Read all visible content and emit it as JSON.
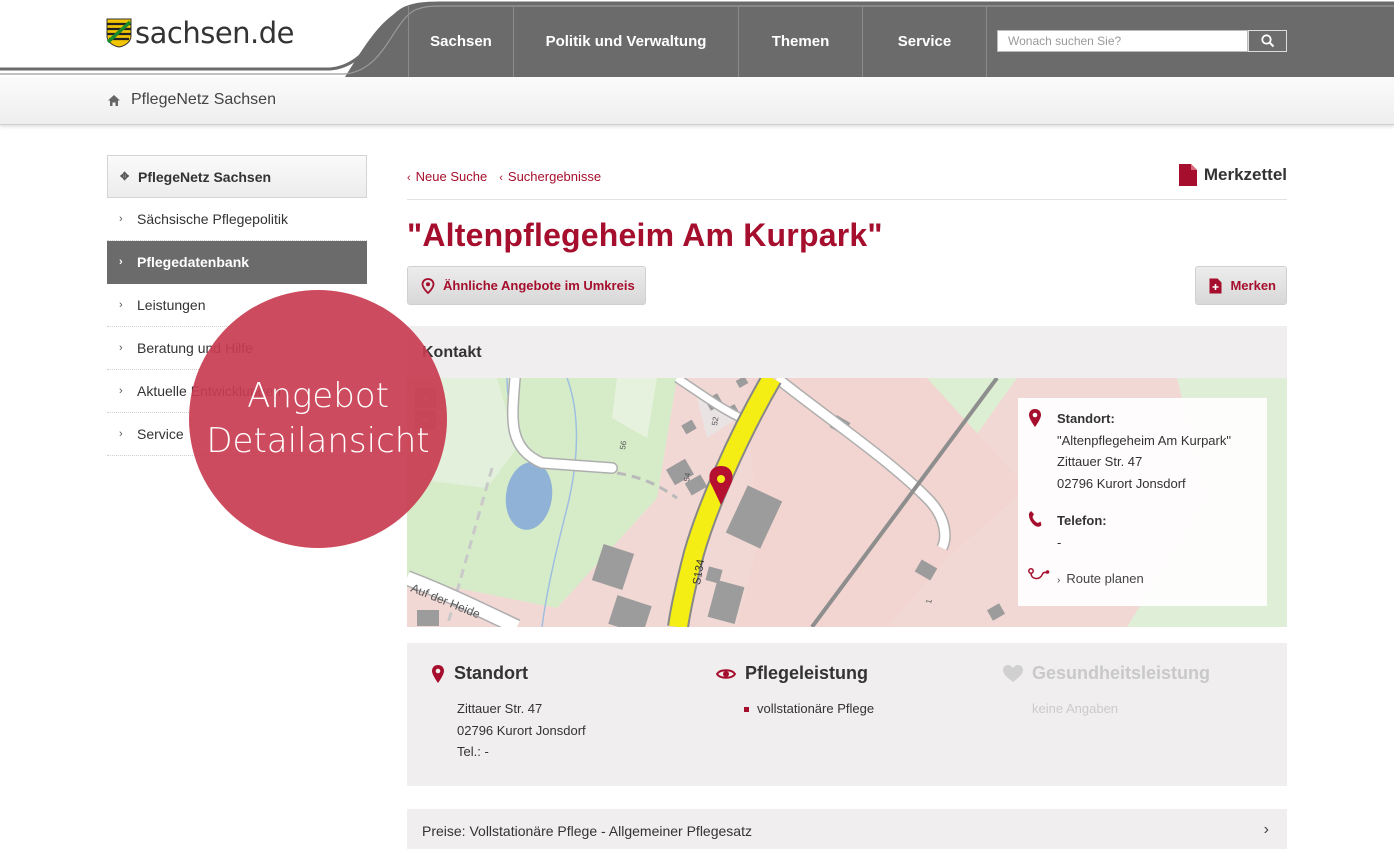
{
  "header": {
    "logo_text": "sachsen.de",
    "nav": [
      {
        "label": "Sachsen"
      },
      {
        "label": "Politik und Verwaltung"
      },
      {
        "label": "Themen"
      },
      {
        "label": "Service"
      }
    ],
    "search_placeholder": "Wonach suchen Sie?"
  },
  "breadcrumb": {
    "label": "PflegeNetz Sachsen"
  },
  "sidebar": {
    "items": [
      {
        "label": "PflegeNetz Sachsen"
      },
      {
        "label": "Sächsische Pflegepolitik"
      },
      {
        "label": "Pflegedatenbank"
      },
      {
        "label": "Leistungen"
      },
      {
        "label": "Beratung und Hilfe"
      },
      {
        "label": "Aktuelle Entwicklungen"
      },
      {
        "label": "Service"
      }
    ]
  },
  "overlay": {
    "line1": "Angebot",
    "line2": "Detailansicht"
  },
  "main": {
    "links": {
      "new_search": "Neue Suche",
      "results": "Suchergebnisse"
    },
    "merkzettel": "Merkzettel",
    "title": "\"Altenpflegeheim Am Kurpark\"",
    "btn_similar": "Ähnliche Angebote im Umkreis",
    "btn_merken": "Merken",
    "kontakt_title": "Kontakt"
  },
  "map": {
    "zoom_in": "+",
    "zoom_out": "−",
    "road_label": "S134",
    "street_label": "Auf der Heide",
    "house_numbers": [
      "56",
      "54",
      "52",
      "1"
    ],
    "card": {
      "standort_label": "Standort:",
      "name": "\"Altenpflegeheim Am Kurpark\"",
      "street": "Zittauer Str. 47",
      "city": "02796 Kurort Jonsdorf",
      "telefon_label": "Telefon:",
      "telefon": "-",
      "route": "Route planen"
    }
  },
  "info": {
    "standort": {
      "title": "Standort",
      "street": "Zittauer Str. 47",
      "city": "02796 Kurort Jonsdorf",
      "tel": "Tel.: -"
    },
    "pflege": {
      "title": "Pflegeleistung",
      "item": "vollstationäre Pflege"
    },
    "gesundheit": {
      "title": "Gesundheitsleistung",
      "value": "keine Angaben"
    }
  },
  "price_row": {
    "label": "Preise: Vollstationäre Pflege - Allgemeiner Pflegesatz"
  },
  "colors": {
    "accent": "#a50f2d",
    "nav_bg": "#6b6b6b",
    "panel_bg": "#f0eeee"
  }
}
